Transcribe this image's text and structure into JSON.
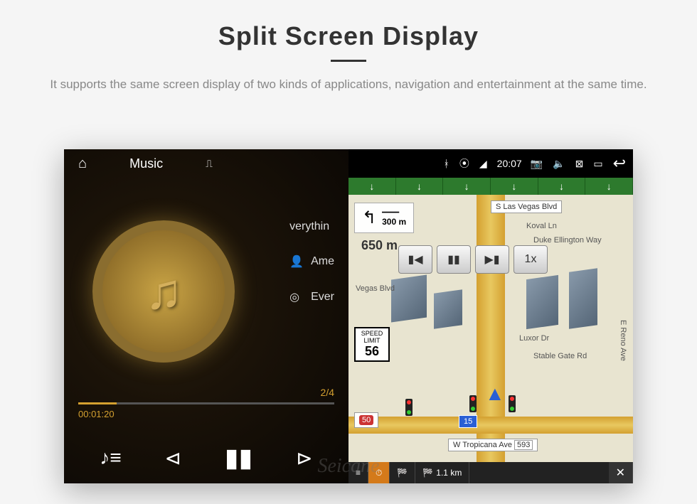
{
  "header": {
    "title": "Split Screen Display",
    "subtitle": "It supports the same screen display of two kinds of applications, navigation and entertainment at the same time."
  },
  "music": {
    "app_label": "Music",
    "track_title": "verythin",
    "artist": "Ame",
    "album": "Ever",
    "counter": "2/4",
    "elapsed": "00:01:20"
  },
  "status": {
    "time": "20:07"
  },
  "nav": {
    "streets": {
      "top": "S Las Vegas Blvd",
      "koval": "Koval Ln",
      "duke": "Duke Ellington Way",
      "vegas": "Vegas Blvd",
      "luxor": "Luxor Dr",
      "stable": "Stable Gate Rd",
      "reno": "E Reno Ave",
      "tropicana": "W Tropicana Ave",
      "tropicana_num": "593"
    },
    "turn_dist": "300 m",
    "approach_dist": "650 m",
    "speed_label": "SPEED LIMIT",
    "speed_value": "56",
    "route_badge": "50",
    "interstate": "15",
    "speed_multiplier": "1x",
    "bottom": {
      "remaining": "1.1 km"
    }
  },
  "watermark": "Seicane"
}
